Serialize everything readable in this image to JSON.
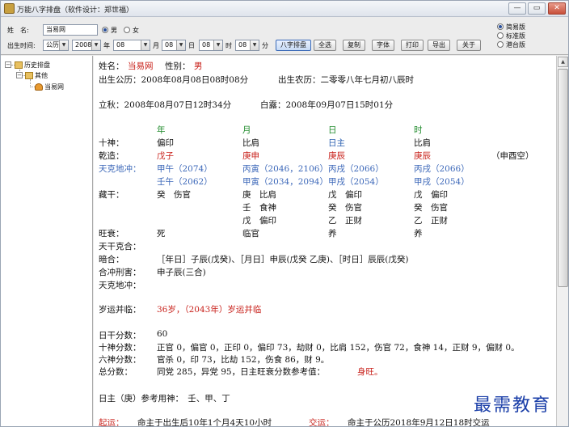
{
  "window": {
    "title": "万能八字排盘（软件设计：郑世福）",
    "min_label": "—",
    "max_label": "▭",
    "close_label": "✕"
  },
  "toolbar": {
    "name_label": "姓　名:",
    "name_value": "当易网",
    "gender_male": "男",
    "gender_female": "女",
    "gender_selected": "male",
    "birth_label": "出生时间:",
    "calendar": "公历",
    "year": "2008",
    "year_label": "年",
    "month": "08",
    "month_label": "月",
    "day": "08",
    "day_label": "日",
    "hour": "08",
    "hour_label": "时",
    "minute": "08",
    "minute_label": "分",
    "buttons": [
      "八字排盘",
      "全选",
      "复制",
      "字体",
      "打印",
      "导出",
      "关于"
    ],
    "active_button": "八字排盘",
    "editions": [
      "简易版",
      "标准版",
      "港台版"
    ],
    "selected_edition": "简易版"
  },
  "tree": {
    "root": "历史排盘",
    "group": "其他",
    "item": "当易网"
  },
  "report": {
    "name_label": "姓名：",
    "name": "当易网",
    "sex_label": "性别：",
    "sex": "男",
    "solar_label": "出生公历：2008年08月08日08时08分",
    "lunar_label": "出生农历：二零零八年七月初八辰时",
    "liqiu": "立秋：2008年08月07日12时34分",
    "bailu": "白露：2008年09月07日15时01分",
    "pillar_headers": [
      "年",
      "月",
      "日",
      "时"
    ],
    "shishen_label": "十神：",
    "shishen": [
      "偏印",
      "比肩",
      "日主",
      "比肩"
    ],
    "qianzao_label": "乾造：",
    "qianzao": [
      "戊子",
      "庚申",
      "庚辰",
      "庚辰"
    ],
    "kongwang": "（申酉空）",
    "tiankedichong_label": "天克地冲：",
    "tkdc_row1": [
      "甲午（2074）",
      "丙寅（2046，2106）",
      "丙戌（2066）",
      "丙戌（2066）"
    ],
    "tkdc_row2": [
      "壬午（2062）",
      "甲寅（2034，2094）",
      "甲戌（2054）",
      "甲戌（2054）"
    ],
    "canggan_label": "藏干：",
    "canggan_year": "癸　伤官",
    "canggan_month": [
      "庚　比肩",
      "壬　食神",
      "戊　偏印"
    ],
    "canggan_day": [
      "戊　偏印",
      "癸　伤官",
      "乙　正财"
    ],
    "canggan_hour": [
      "戊　偏印",
      "癸　伤官",
      "乙　正财"
    ],
    "wangshuai_label": "旺衰：",
    "wangshuai": [
      "死",
      "临官",
      "养",
      "养"
    ],
    "tiangan_label": "天干克合：",
    "anhe_label": "暗合：",
    "anhe": "［年日］子辰(戊癸)、［月日］申辰(戊癸 乙庚)、［时日］辰辰(戊癸)",
    "hechong_label": "合冲刑害：",
    "hechong": "申子辰(三合)",
    "tiankedichong2_label": "天克地冲：",
    "suiyun_label": "岁运并临：",
    "suiyun": "36岁，（2043年）岁运并临",
    "rigan_label": "日干分数：",
    "rigan": "60",
    "shishen_fen_label": "十神分数：",
    "shishen_fen": "正官 0，偏官 0，正印 0，偏印 73，劫财 0，比肩 152，伤官 72，食神 14，正财 9，偏财 0。",
    "liushen_label": "六神分数：",
    "liushen": "官杀 0，印 73，比劫 152，伤食 86，财 9。",
    "zongfen_label": "总分数：",
    "zongfen_text": "同党 285，异党 95，日主旺衰分数参考值：",
    "zongfen_result": "身旺。",
    "yongshen": "日主（庚）参考用神：　壬、甲、丁",
    "qiyun_label": "起运：",
    "qiyun": "命主于出生后10年1个月4天10小时",
    "jiaoyun_label": "交运：",
    "jiaoyun": "命主于公历2018年9月12日18时交运"
  },
  "watermark": "最需教育"
}
